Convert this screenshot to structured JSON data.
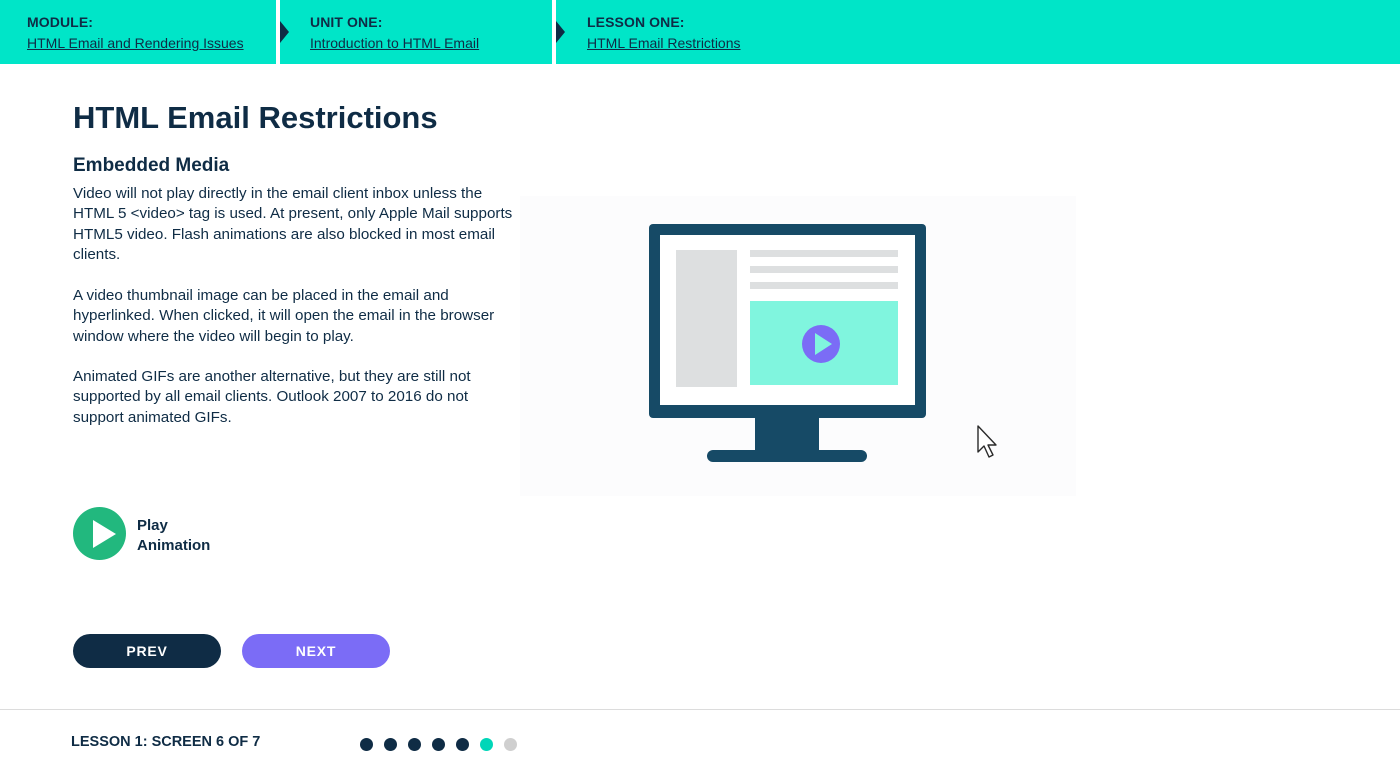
{
  "breadcrumbs": [
    {
      "title": "MODULE:",
      "link": "HTML Email and Rendering Issues"
    },
    {
      "title": "UNIT ONE:",
      "link": "Introduction to HTML Email"
    },
    {
      "title": "LESSON ONE:",
      "link": "HTML Email Restrictions"
    }
  ],
  "content": {
    "title": "HTML Email Restrictions",
    "section": "Embedded Media",
    "paragraphs": [
      "Video will not play directly in the email client inbox unless the HTML 5 <video> tag is used. At present, only Apple Mail supports HTML5 video. Flash animations are also blocked in most email clients.",
      "A video thumbnail image can be placed in the email and hyperlinked. When clicked, it will open the email in the browser window where the video will begin to play.",
      "Animated GIFs are another alternative, but they are still not supported by all email clients. Outlook 2007 to 2016 do not support animated GIFs."
    ]
  },
  "play_animation": {
    "line1": "Play",
    "line2": "Animation",
    "icon": "play-icon"
  },
  "buttons": {
    "prev": "PREV",
    "next": "NEXT"
  },
  "footer": {
    "status": "LESSON 1: SCREEN 6 OF 7",
    "total_screens": 7,
    "current_screen": 6
  },
  "colors": {
    "header_bg": "#00e5c8",
    "navy": "#0f2c45",
    "play_green": "#22b87e",
    "next_purple": "#7b6cf6",
    "dot_done": "#0f2c45",
    "dot_current": "#00d6b8",
    "dot_todo": "#cfcfcf"
  },
  "illustration": {
    "icons": [
      "monitor-icon",
      "video-play-icon",
      "mouse-cursor-icon"
    ]
  }
}
